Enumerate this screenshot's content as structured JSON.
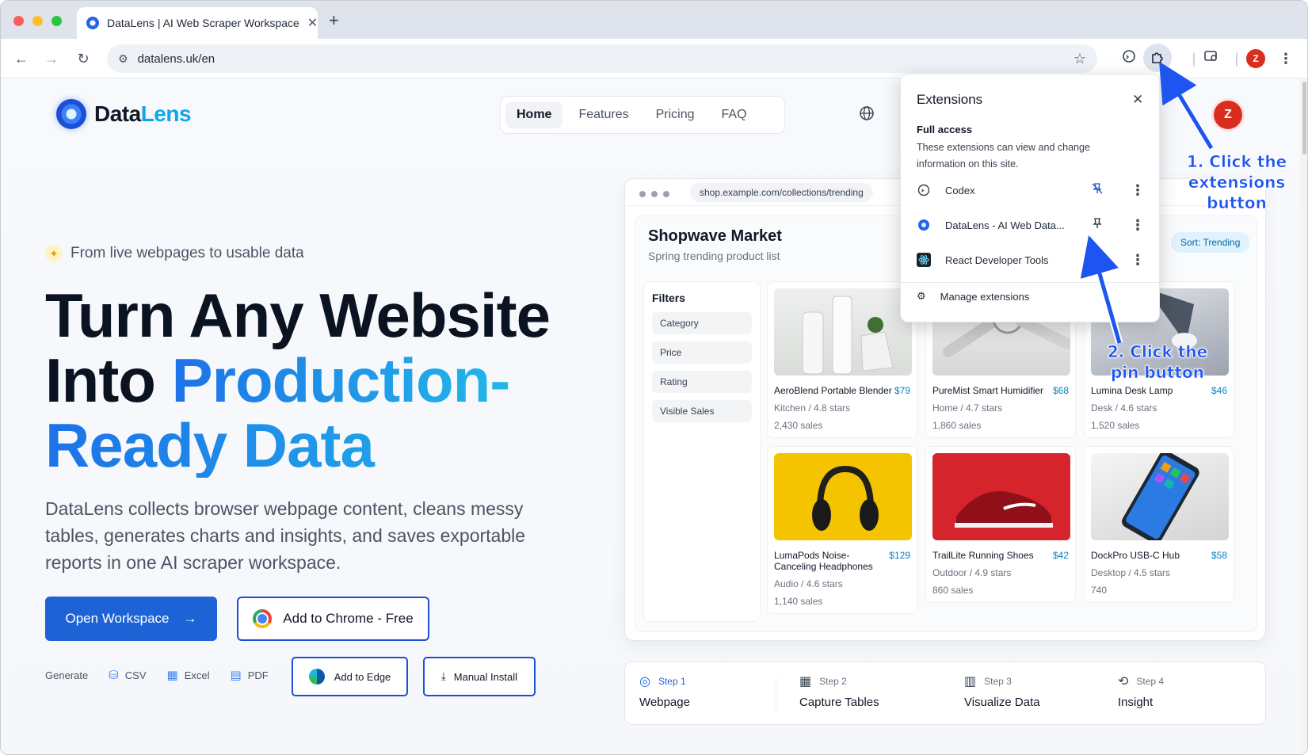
{
  "browser": {
    "tab_title": "DataLens | AI Web Scraper Workspace",
    "url": "datalens.uk/en",
    "profile_initial": "Z"
  },
  "site": {
    "logo_part1": "Data",
    "logo_part2": "Lens",
    "nav": [
      "Home",
      "Features",
      "Pricing",
      "FAQ"
    ],
    "avatar_initial": "Z"
  },
  "hero": {
    "eyebrow": "From live webpages to usable data",
    "headline_line1": "Turn Any Website",
    "headline_into": "Into ",
    "headline_grad1": "Production-",
    "headline_grad2": "Ready Data",
    "subtext": "DataLens collects browser webpage content, cleans messy tables, generates charts and insights, and saves exportable reports in one AI scraper workspace.",
    "open_workspace": "Open Workspace",
    "add_chrome": "Add to Chrome - Free",
    "generate_label": "Generate",
    "formats": [
      "CSV",
      "Excel",
      "PDF"
    ],
    "add_edge": "Add to Edge",
    "manual_install": "Manual Install"
  },
  "mock": {
    "url": "shop.example.com/collections/trending",
    "shop_title": "Shopwave Market",
    "shop_subtitle": "Spring trending product list",
    "sort": "Sort: Trending",
    "filters_title": "Filters",
    "filters": [
      "Category",
      "Price",
      "Rating",
      "Visible Sales"
    ],
    "products": [
      {
        "name": "AeroBlend Portable Blender",
        "price": "$79",
        "meta": "Kitchen / 4.8 stars",
        "sales": "2,430 sales"
      },
      {
        "name": "PureMist Smart Humidifier",
        "price": "$68",
        "meta": "Home / 4.7 stars",
        "sales": "1,860 sales"
      },
      {
        "name": "Lumina Desk Lamp",
        "price": "$46",
        "meta": "Desk / 4.6 stars",
        "sales": "1,520 sales"
      },
      {
        "name": "LumaPods Noise-Canceling Headphones",
        "price": "$129",
        "meta": "Audio / 4.6 stars",
        "sales": "1,140 sales"
      },
      {
        "name": "TrailLite Running Shoes",
        "price": "$42",
        "meta": "Outdoor / 4.9 stars",
        "sales": "860 sales"
      },
      {
        "name": "DockPro USB-C Hub",
        "price": "$58",
        "meta": "Desktop / 4.5 stars",
        "sales": "740"
      }
    ]
  },
  "steps": [
    {
      "label": "Step 1",
      "name": "Webpage"
    },
    {
      "label": "Step 2",
      "name": "Capture Tables"
    },
    {
      "label": "Step 3",
      "name": "Visualize Data"
    },
    {
      "label": "Step 4",
      "name": "Insight"
    }
  ],
  "extensions": {
    "title": "Extensions",
    "section": "Full access",
    "description": "These extensions can view and change information on this site.",
    "items": [
      {
        "name": "Codex",
        "pinned": true
      },
      {
        "name": "DataLens - AI Web Data...",
        "pinned": false
      },
      {
        "name": "React Developer Tools",
        "pinned": false
      }
    ],
    "manage": "Manage extensions"
  },
  "annotations": {
    "step1_line1": "1. Click the",
    "step1_line2": "extensions button",
    "step2_line1": "2. Click the",
    "step2_line2": "pin button"
  },
  "colors": {
    "brand_blue": "#1d63d6",
    "accent_cyan": "#0ea5e9",
    "annotation_blue": "#1e54f0",
    "avatar_red": "#d92d20"
  }
}
